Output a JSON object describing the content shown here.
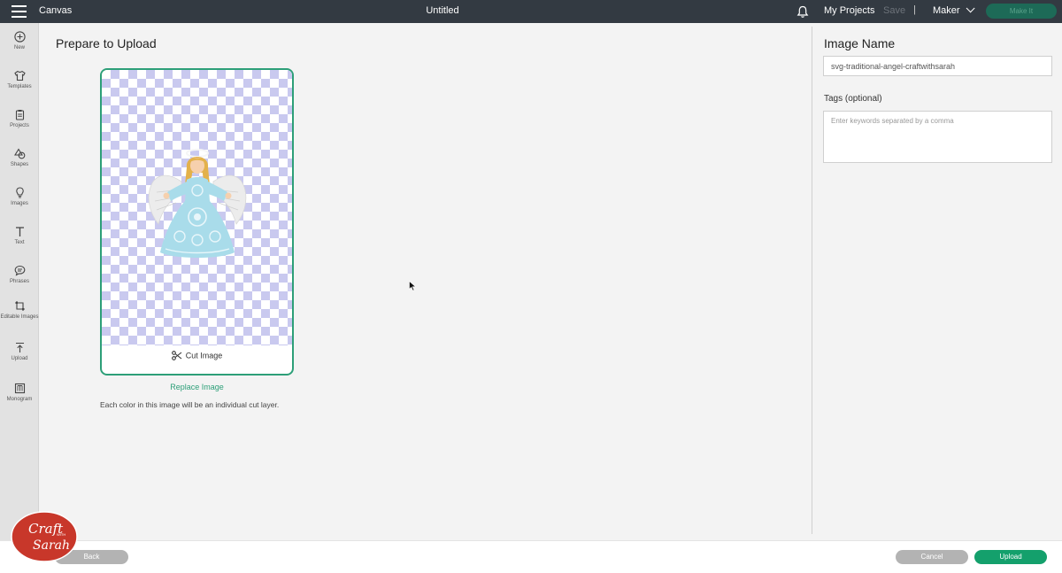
{
  "topbar": {
    "app_title": "Canvas",
    "document_title": "Untitled",
    "my_projects": "My Projects",
    "save": "Save",
    "separator": "|",
    "machine": "Maker",
    "make_it": "Make It"
  },
  "sidebar": {
    "items": [
      {
        "label": "New",
        "icon": "plus-circle-icon"
      },
      {
        "label": "Templates",
        "icon": "shirt-icon"
      },
      {
        "label": "Projects",
        "icon": "clipboard-icon"
      },
      {
        "label": "Shapes",
        "icon": "shapes-icon"
      },
      {
        "label": "Images",
        "icon": "lightbulb-icon"
      },
      {
        "label": "Text",
        "icon": "text-icon"
      },
      {
        "label": "Phrases",
        "icon": "speech-bubble-icon"
      },
      {
        "label": "Editable Images",
        "icon": "editable-image-icon"
      },
      {
        "label": "Upload",
        "icon": "upload-icon"
      },
      {
        "label": "Monogram",
        "icon": "monogram-icon"
      }
    ]
  },
  "main": {
    "title": "Prepare to Upload",
    "cut_image_label": "Cut Image",
    "replace_image": "Replace Image",
    "note": "Each color in this image will be an individual cut layer."
  },
  "right_panel": {
    "title": "Image Name",
    "image_name_value": "svg-traditional-angel-craftwithsarah",
    "tags_label": "Tags (optional)",
    "tags_placeholder": "Enter keywords separated by a comma"
  },
  "bottombar": {
    "back": "Back",
    "cancel": "Cancel",
    "upload": "Upload"
  },
  "logo": {
    "line1": "Craft",
    "small": "WITH",
    "line2": "Sarah"
  },
  "colors": {
    "topbar": "#333a42",
    "accent_green": "#14a06c",
    "card_border": "#2d9f78",
    "logo_red": "#c8372a"
  }
}
